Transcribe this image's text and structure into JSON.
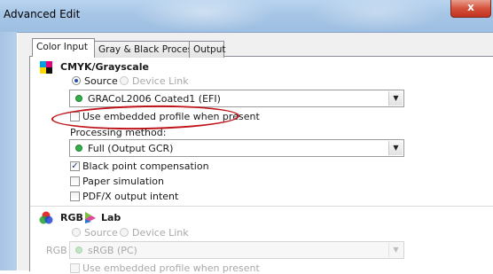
{
  "window": {
    "title": "Advanced Edit",
    "close_label": "x"
  },
  "tabs": [
    {
      "label": "Color Input"
    },
    {
      "label": "Gray & Black Processing"
    },
    {
      "label": "Output"
    }
  ],
  "cmyk": {
    "title": "CMYK/Grayscale",
    "radio_source": "Source",
    "radio_device_link": "Device Link",
    "profile_value": "GRACoL2006 Coated1 (EFI)",
    "use_embedded_label": "Use embedded profile when present",
    "processing_label": "Processing method:",
    "processing_value": "Full (Output GCR)",
    "black_point_label": "Black point compensation",
    "black_point_checked": true,
    "paper_sim_label": "Paper simulation",
    "pdfx_label": "PDF/X output intent"
  },
  "rgb": {
    "title_rgb": "RGB",
    "title_lab": "Lab",
    "radio_source": "Source",
    "radio_device_link": "Device Link",
    "row_label": "RGB",
    "profile_value": "sRGB (PC)",
    "use_embedded_label": "Use embedded profile when present"
  },
  "colors": {
    "highlight_ellipse": "#c0141b",
    "titlebar": "#a6c5e6",
    "close_button": "#c0331f"
  }
}
